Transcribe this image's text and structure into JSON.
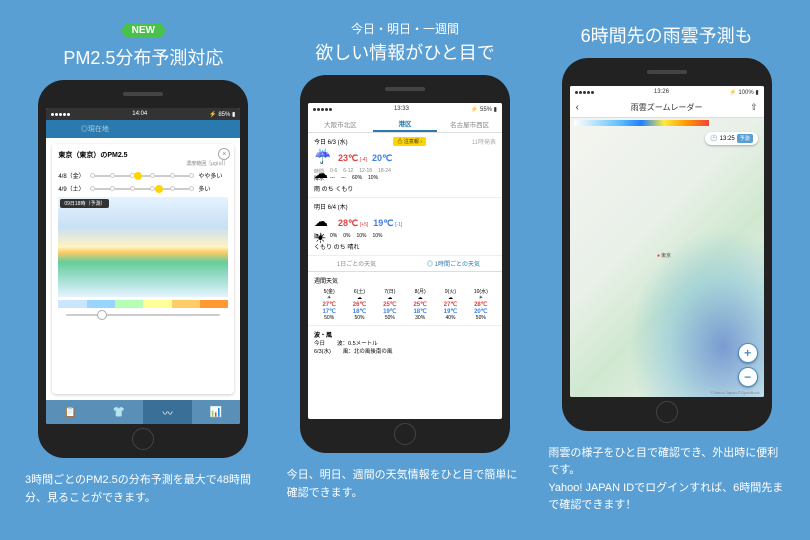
{
  "col1": {
    "badge": "NEW",
    "title": "PM2.5分布予測対応",
    "desc": "3時間ごとのPM2.5の分布予測を最大で48時間分、見ることができます。",
    "status": {
      "time": "14:04",
      "battery": "85%"
    },
    "nav": {
      "tab1": "◎現在地",
      "tab2": ""
    },
    "card": {
      "location": "東京（東京）のPM2.5",
      "unit": "濃度範囲［μg/㎥］",
      "rows": [
        {
          "date": "4/8（金）",
          "level": "やや多い"
        },
        {
          "date": "4/9（土）",
          "level": "多い"
        }
      ],
      "mapLabel": "09日18時（予測）"
    }
  },
  "col2": {
    "subtitle": "今日・明日・一週間",
    "title": "欲しい情報がひと目で",
    "desc": "今日、明日、週間の天気情報をひと目で簡単に確認できます。",
    "status": {
      "time": "13:33",
      "battery": "55%"
    },
    "locTabs": [
      "大阪市北区",
      "港区",
      "名古屋市西区"
    ],
    "today": {
      "dateLabel": "今日 6/3 (水)",
      "alert": "注意報",
      "updateTime": "11時発表",
      "icon": "☔☁",
      "hiTemp": "23",
      "hiDiff": "[-4]",
      "loTemp": "20",
      "loDiff": "",
      "precipLabel": "時間",
      "precipSlots": [
        "0-6",
        "6-12",
        "12-18",
        "18-24"
      ],
      "precipVals": [
        "---",
        "---",
        "60%",
        "10%"
      ],
      "precipRowLabel": "降水",
      "desc": "雨 のち くもり"
    },
    "tomorrow": {
      "dateLabel": "明日 6/4 (木)",
      "icon": "☁☀",
      "hiTemp": "28",
      "hiDiff": "[+5]",
      "loTemp": "19",
      "loDiff": "[-1]",
      "precipVals": [
        "0%",
        "0%",
        "10%",
        "10%"
      ],
      "desc": "くもり のち 晴れ"
    },
    "viewTabs": [
      "1日ごとの天気",
      "◎ 1時間ごとの天気"
    ],
    "week": {
      "title": "週間天気",
      "days": [
        {
          "d": "5(金)",
          "i": "☀",
          "hi": "27℃",
          "lo": "17℃",
          "p": "50%"
        },
        {
          "d": "6(土)",
          "i": "☁",
          "hi": "26℃",
          "lo": "18℃",
          "p": "50%"
        },
        {
          "d": "7(日)",
          "i": "☁",
          "hi": "25℃",
          "lo": "19℃",
          "p": "50%"
        },
        {
          "d": "8(月)",
          "i": "☁",
          "hi": "25℃",
          "lo": "18℃",
          "p": "30%"
        },
        {
          "d": "9(火)",
          "i": "☁",
          "hi": "27℃",
          "lo": "19℃",
          "p": "40%"
        },
        {
          "d": "10(水)",
          "i": "☀",
          "hi": "28℃",
          "lo": "20℃",
          "p": "50%"
        }
      ]
    },
    "wave": {
      "title": "波・風",
      "rows": [
        {
          "l": "今日",
          "v": "波：0.5メートル"
        },
        {
          "l": "6/3(水)",
          "v": "風：北の風後南の風"
        }
      ]
    }
  },
  "col3": {
    "title": "6時間先の雨雲予測も",
    "desc": "雨雲の様子をひと目で確認でき、外出時に便利です。\nYahoo! JAPAN IDでログインすれば、6時間先まで確認できます！",
    "status": {
      "time": "13:26",
      "battery": "100%"
    },
    "nav": {
      "title": "雨雲ズームレーダー"
    },
    "map": {
      "time": "13:25",
      "forecastBtn": "予測",
      "cities": {
        "tokyo": "東京"
      },
      "copyright": "©Yahoo Japan,©OpenBook"
    }
  }
}
